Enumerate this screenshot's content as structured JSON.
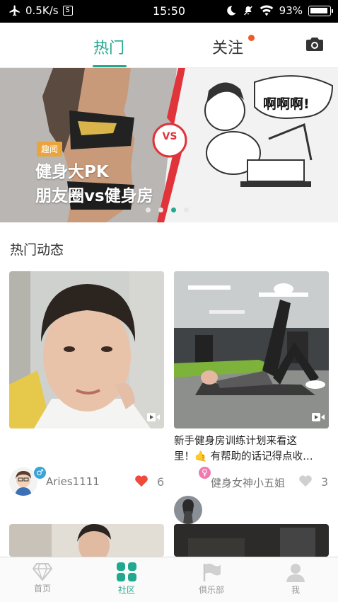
{
  "status_bar": {
    "network_speed": "0.5K/s",
    "sim_badge": "S",
    "time": "15:50",
    "battery": "93%"
  },
  "top_nav": {
    "tabs": [
      {
        "label": "热门",
        "active": true
      },
      {
        "label": "关注",
        "active": false,
        "has_badge": true
      }
    ],
    "camera_icon": "camera-icon"
  },
  "banner": {
    "tag": "趣闻",
    "title_line1": "健身大PK",
    "title_line2": "朋友圈vs健身房",
    "vs_text": "VS",
    "cartoon_text": "啊啊啊!",
    "dots": 4,
    "active_dot": 3
  },
  "section": {
    "title": "热门动态"
  },
  "posts": [
    {
      "has_video": true,
      "description": "",
      "username": "Aries1111",
      "gender": "male",
      "gender_symbol": "♂",
      "likes": "6",
      "liked": true
    },
    {
      "has_video": true,
      "description_line1": "新手健身房训练计划来看这",
      "description_line2": "里！🤙 有帮助的话记得点收…",
      "username": "健身女神小五姐",
      "gender": "female",
      "gender_symbol": "♀",
      "likes": "3",
      "liked": false
    }
  ],
  "bottom_nav": [
    {
      "label": "首页",
      "icon": "diamond-icon",
      "active": false
    },
    {
      "label": "社区",
      "icon": "grid-icon",
      "active": true
    },
    {
      "label": "俱乐部",
      "icon": "flag-icon",
      "active": false
    },
    {
      "label": "我",
      "icon": "person-icon",
      "active": false
    }
  ],
  "colors": {
    "accent": "#21a98f",
    "badge": "#f05a28",
    "heart_active": "#ef4a3c",
    "male": "#3aa3d8",
    "female": "#f07ab0"
  }
}
